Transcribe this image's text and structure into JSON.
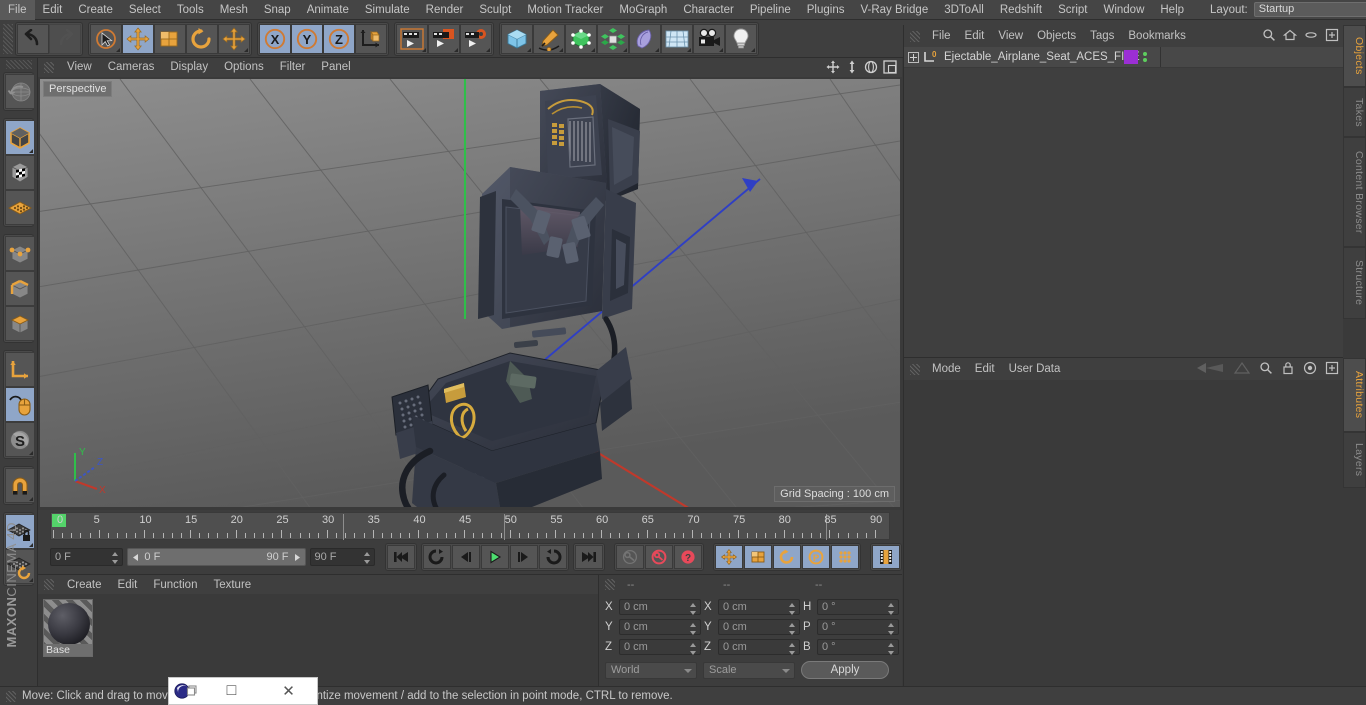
{
  "menubar": {
    "items": [
      "File",
      "Edit",
      "Create",
      "Select",
      "Tools",
      "Mesh",
      "Snap",
      "Animate",
      "Simulate",
      "Render",
      "Sculpt",
      "Motion Tracker",
      "MoGraph",
      "Character",
      "Pipeline",
      "Plugins",
      "V-Ray Bridge",
      "3DToAll",
      "Redshift",
      "Script",
      "Window",
      "Help"
    ],
    "layout_label": "Layout:",
    "layout_value": "Startup",
    "icons": [
      "search-icon",
      "home-icon",
      "minimize-icon",
      "maximize-icon"
    ]
  },
  "toolbar": {
    "groups": [
      {
        "name": "history",
        "buttons": [
          {
            "icon": "undo-icon",
            "selected": false,
            "disabled": false,
            "corner": false
          },
          {
            "icon": "redo-icon",
            "selected": false,
            "disabled": true,
            "corner": false
          }
        ]
      },
      {
        "name": "transform",
        "buttons": [
          {
            "icon": "live-selection-icon",
            "selected": false,
            "disabled": false,
            "corner": true
          },
          {
            "icon": "move-icon",
            "selected": true,
            "disabled": false,
            "corner": false
          },
          {
            "icon": "scale-icon",
            "selected": false,
            "disabled": false,
            "corner": false
          },
          {
            "icon": "rotate-icon",
            "selected": false,
            "disabled": false,
            "corner": false
          },
          {
            "icon": "move-alt-icon",
            "selected": false,
            "disabled": false,
            "corner": true
          }
        ]
      },
      {
        "name": "axis-lock",
        "buttons": [
          {
            "icon": "x-axis-icon",
            "selected": true,
            "disabled": false,
            "corner": false
          },
          {
            "icon": "y-axis-icon",
            "selected": true,
            "disabled": false,
            "corner": false
          },
          {
            "icon": "z-axis-icon",
            "selected": true,
            "disabled": false,
            "corner": false
          },
          {
            "icon": "world-coordinate-icon",
            "selected": false,
            "disabled": false,
            "corner": false
          }
        ]
      },
      {
        "name": "render",
        "buttons": [
          {
            "icon": "render-view-icon",
            "selected": false,
            "disabled": false,
            "corner": true
          },
          {
            "icon": "render-region-icon",
            "selected": false,
            "disabled": false,
            "corner": true
          },
          {
            "icon": "render-settings-icon",
            "selected": false,
            "disabled": false,
            "corner": true
          }
        ]
      },
      {
        "name": "create",
        "buttons": [
          {
            "icon": "cube-primitive-icon",
            "selected": false,
            "disabled": false,
            "corner": true
          },
          {
            "icon": "spline-pen-icon",
            "selected": false,
            "disabled": false,
            "corner": true
          },
          {
            "icon": "generator-icon",
            "selected": false,
            "disabled": false,
            "corner": true
          },
          {
            "icon": "mograph-icon",
            "selected": false,
            "disabled": false,
            "corner": true
          },
          {
            "icon": "deformer-icon",
            "selected": false,
            "disabled": false,
            "corner": true
          },
          {
            "icon": "scene-environment-icon",
            "selected": false,
            "disabled": false,
            "corner": true
          },
          {
            "icon": "camera-icon",
            "selected": false,
            "disabled": false,
            "corner": true
          },
          {
            "icon": "light-icon",
            "selected": false,
            "disabled": false,
            "corner": true
          }
        ]
      }
    ]
  },
  "leftbar": {
    "groups": [
      {
        "buttons": [
          {
            "icon": "undo-sphere-icon",
            "selected": false,
            "corner": false
          }
        ]
      },
      {
        "buttons": [
          {
            "icon": "model-mode-icon",
            "selected": true,
            "corner": true
          },
          {
            "icon": "texture-mode-icon",
            "selected": false,
            "corner": false
          },
          {
            "icon": "workplane-icon",
            "selected": false,
            "corner": false
          }
        ]
      },
      {
        "buttons": [
          {
            "icon": "point-mode-icon",
            "selected": false,
            "corner": false
          },
          {
            "icon": "edge-mode-icon",
            "selected": false,
            "corner": false
          },
          {
            "icon": "polygon-mode-icon",
            "selected": false,
            "corner": false
          }
        ]
      },
      {
        "buttons": [
          {
            "icon": "axis-modify-icon",
            "selected": false,
            "corner": false
          },
          {
            "icon": "viewport-solo-mouse-icon",
            "selected": true,
            "corner": false
          },
          {
            "icon": "enable-axis-s-icon",
            "selected": false,
            "corner": true
          }
        ]
      },
      {
        "buttons": [
          {
            "icon": "magnet-icon",
            "selected": false,
            "corner": true
          }
        ]
      },
      {
        "buttons": [
          {
            "icon": "workplane-lock-icon",
            "selected": true,
            "corner": true
          },
          {
            "icon": "workplane-rotate-icon",
            "selected": false,
            "corner": true
          }
        ]
      }
    ],
    "brand_bold": "MAXON",
    "brand_light": "CINEMA 4D"
  },
  "viewport": {
    "menu": [
      "View",
      "Cameras",
      "Display",
      "Options",
      "Filter",
      "Panel"
    ],
    "icons": [
      "pan-icon",
      "dolly-icon",
      "orbit-icon",
      "maximize-view-icon"
    ],
    "perspective_label": "Perspective",
    "grid_spacing_label": "Grid Spacing : 100 cm",
    "axis_gizmo": {
      "y": "Y",
      "z": "Z",
      "x": "X"
    },
    "model": "ejection-seat-3d-model"
  },
  "timeline": {
    "ruler_labels": [
      0,
      5,
      10,
      15,
      20,
      25,
      30,
      35,
      40,
      45,
      50,
      55,
      60,
      65,
      70,
      75,
      80,
      85,
      90
    ],
    "current_frame_marker": 0,
    "fields": {
      "current_frame": "0 F",
      "end_display": "0 F",
      "range_start": "0 F",
      "range_end": "90 F",
      "preview_end": "90 F"
    },
    "transport": [
      {
        "icon": "go-to-start-icon",
        "selected": false
      },
      {
        "icon": "play-backwards-loop-icon",
        "selected": false
      },
      {
        "icon": "step-back-icon",
        "selected": false
      },
      {
        "icon": "play-forward-icon",
        "selected": false
      },
      {
        "icon": "step-forward-icon",
        "selected": false
      },
      {
        "icon": "loop-icon",
        "selected": false
      },
      {
        "icon": "go-to-end-icon",
        "selected": false
      }
    ],
    "keyframe_buttons": [
      {
        "icon": "record-key-icon",
        "selected": false,
        "disabled": true
      },
      {
        "icon": "autokey-icon",
        "selected": false,
        "disabled": false
      },
      {
        "icon": "keyframe-selection-icon",
        "selected": false,
        "disabled": false
      }
    ],
    "key_filters": [
      {
        "icon": "position-key-icon",
        "selected": true
      },
      {
        "icon": "scale-key-icon",
        "selected": true
      },
      {
        "icon": "rotation-key-icon",
        "selected": true
      },
      {
        "icon": "parameter-key-icon",
        "selected": true
      },
      {
        "icon": "point-level-anim-icon",
        "selected": true
      }
    ],
    "timeline_toggle": {
      "icon": "timeline-filmstrip-icon",
      "selected": true
    }
  },
  "material_manager": {
    "menu": [
      "Create",
      "Edit",
      "Function",
      "Texture"
    ],
    "materials": [
      {
        "name": "Base"
      }
    ]
  },
  "coordinates": {
    "headers": [
      "--",
      "--",
      "--"
    ],
    "rows": [
      {
        "pos_label": "X",
        "pos_value": "0 cm",
        "size_label": "X",
        "size_value": "0 cm",
        "rot_label": "H",
        "rot_value": "0 °"
      },
      {
        "pos_label": "Y",
        "pos_value": "0 cm",
        "size_label": "Y",
        "size_value": "0 cm",
        "rot_label": "P",
        "rot_value": "0 °"
      },
      {
        "pos_label": "Z",
        "pos_value": "0 cm",
        "size_label": "Z",
        "size_value": "0 cm",
        "rot_label": "B",
        "rot_value": "0 °"
      }
    ],
    "system_select": "World",
    "mode_select": "Scale",
    "apply_label": "Apply"
  },
  "object_manager": {
    "menu": [
      "File",
      "Edit",
      "View",
      "Objects",
      "Tags",
      "Bookmarks"
    ],
    "icons": [
      "search-icon",
      "home-icon",
      "ellipse-icon",
      "plus-box-icon"
    ],
    "objects": [
      {
        "name": "Ejectable_Airplane_Seat_ACES_FIVE",
        "icon": "null-object-icon",
        "tag_color": "#9b2fd4"
      }
    ]
  },
  "attributes": {
    "menu": [
      "Mode",
      "Edit",
      "User Data"
    ],
    "icons": [
      "arrow-left-icon",
      "arrow-right-icon",
      "search-icon",
      "lock-icon",
      "target-icon",
      "plus-box-icon"
    ]
  },
  "right_tabs": {
    "top": [
      {
        "label": "Objects",
        "active": true
      },
      {
        "label": "Takes",
        "active": false
      },
      {
        "label": "Content Browser",
        "active": false
      },
      {
        "label": "Structure",
        "active": false
      }
    ],
    "bottom": [
      {
        "label": "Attributes",
        "active": true
      },
      {
        "label": "Layers",
        "active": false
      }
    ]
  },
  "statusbar": {
    "text": "Move: Click and drag to move the selection, SHIFT to quantize movement / add to the selection in point mode, CTRL to remove."
  },
  "overlay_window": {
    "icon": "cinema4d-app-icon",
    "restore_label": "□",
    "close_label": "✕"
  },
  "colors": {
    "accent_orange": "#e8a33d",
    "selected_blue": "#8fa6c8",
    "panel_bg": "#3d3d3d",
    "green_axis": "#39c451",
    "red_axis": "#c44a3d",
    "blue_axis": "#3d56c4"
  }
}
